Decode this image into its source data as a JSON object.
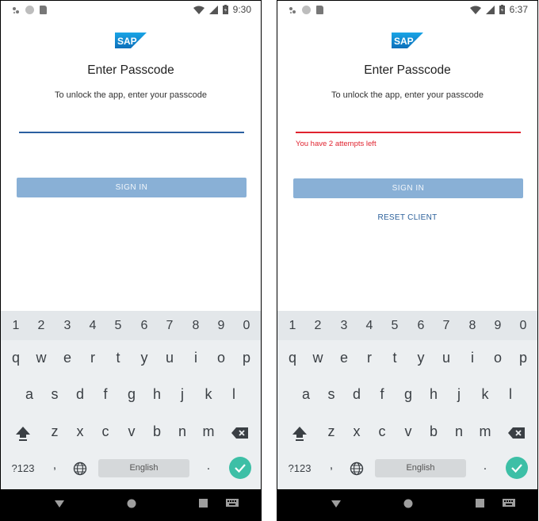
{
  "colors": {
    "accent": "#2a5fa0",
    "error": "#e0232f",
    "button_bg": "#89b0d6",
    "enter_key": "#3dbfa6",
    "keyboard_bg": "#eceff1"
  },
  "screens": [
    {
      "status_time": "9:30",
      "title": "Enter Passcode",
      "subtitle": "To unlock the app, enter your passcode",
      "passcode_value": "",
      "error_text": "",
      "signin_label": "SIGN IN",
      "reset_label": ""
    },
    {
      "status_time": "6:37",
      "title": "Enter Passcode",
      "subtitle": "To unlock the app, enter your passcode",
      "passcode_value": "",
      "error_text": "You have 2 attempts left",
      "signin_label": "SIGN IN",
      "reset_label": "RESET CLIENT"
    }
  ],
  "logo_text": "SAP",
  "keyboard": {
    "numbers": [
      "1",
      "2",
      "3",
      "4",
      "5",
      "6",
      "7",
      "8",
      "9",
      "0"
    ],
    "row1": [
      "q",
      "w",
      "e",
      "r",
      "t",
      "y",
      "u",
      "i",
      "o",
      "p"
    ],
    "row2": [
      "a",
      "s",
      "d",
      "f",
      "g",
      "h",
      "j",
      "k",
      "l"
    ],
    "row3": [
      "z",
      "x",
      "c",
      "v",
      "b",
      "n",
      "m"
    ],
    "symbols_label": "?123",
    "comma": ",",
    "space_label": "English",
    "period": ".",
    "icons": [
      "shift-icon",
      "backspace-icon",
      "globe-icon",
      "checkmark-icon"
    ]
  },
  "navbar_icons": [
    "back-icon",
    "home-icon",
    "recents-icon",
    "keyboard-switch-icon"
  ]
}
